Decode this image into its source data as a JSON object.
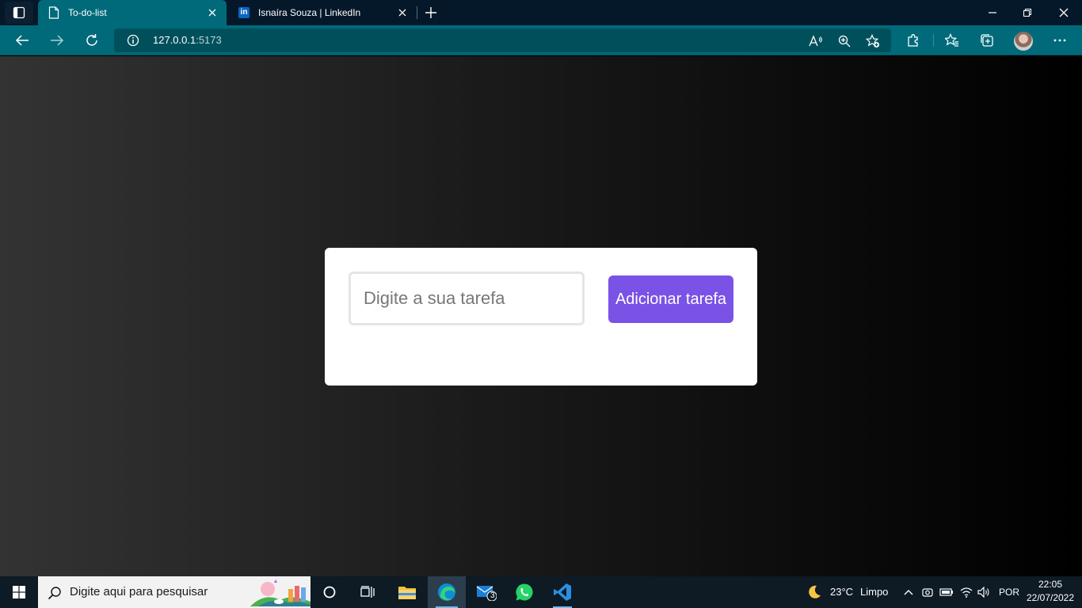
{
  "browser": {
    "tabs": [
      {
        "title": "To-do-list",
        "active": true
      },
      {
        "title": "Isnaíra Souza | LinkedIn",
        "active": false
      }
    ],
    "linkedin_fav_text": "in",
    "address": {
      "host": "127.0.0.1",
      "port": ":5173"
    },
    "tab_bg": "#05182a",
    "toolbar_color": "#006a7a"
  },
  "app": {
    "input_placeholder": "Digite a sua tarefa",
    "input_value": "",
    "add_button_label": "Adicionar tarefa",
    "accent_color": "#7b52e6"
  },
  "taskbar": {
    "search_placeholder": "Digite aqui para pesquisar",
    "mail_badge": "3",
    "weather_temp": "23°C",
    "weather_text": "Limpo",
    "language": "POR",
    "time": "22:05",
    "date": "22/07/2022"
  }
}
